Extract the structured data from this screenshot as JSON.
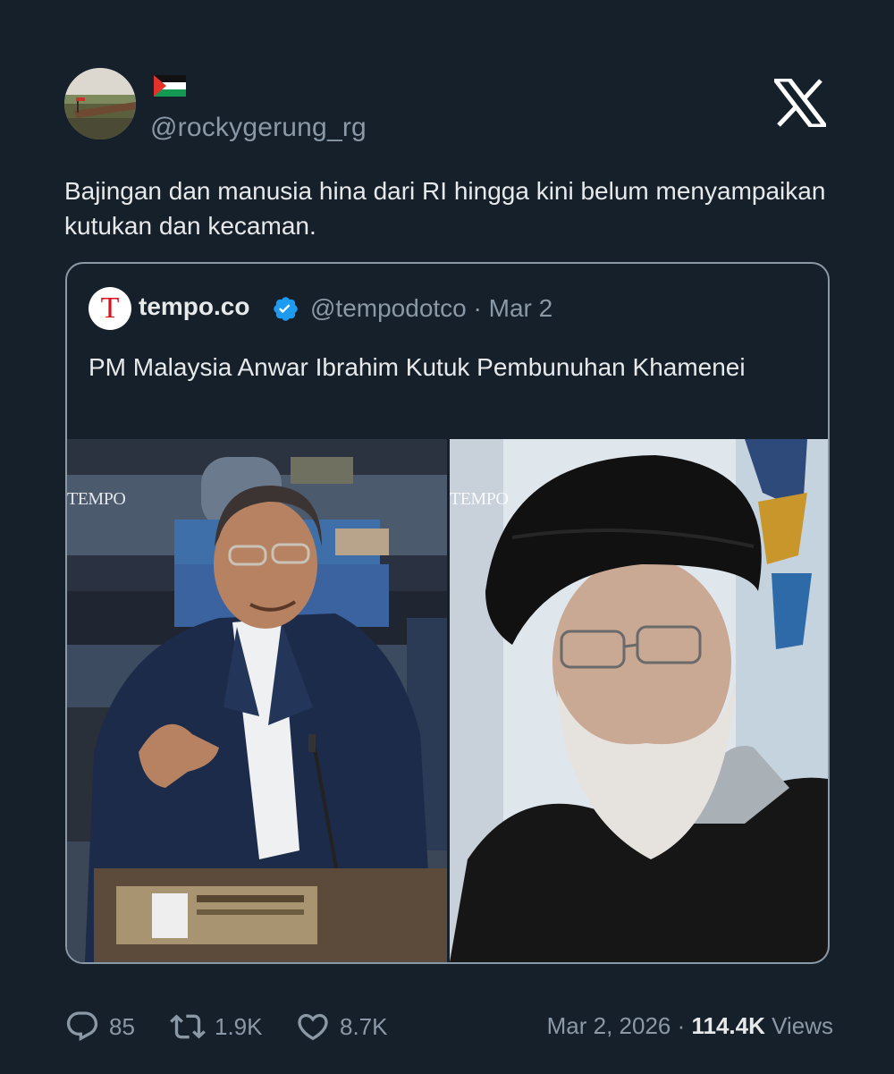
{
  "author": {
    "handle": "@rockygerung_rg",
    "flag_emoji": "palestine-flag"
  },
  "brand_icon": "x-logo-icon",
  "tweet": {
    "text": "Bajingan dan manusia hina dari RI hingga kini belum menyampaikan kutukan dan kecaman."
  },
  "quote": {
    "logo_letter": "T",
    "name": "tempo.co",
    "verified": true,
    "handle": "@tempodotco",
    "separator": " · ",
    "date": "Mar 2",
    "text": "PM Malaysia Anwar Ibrahim Kutuk Pembunuhan Khamenei",
    "watermark_left": "TEMPO",
    "watermark_right": "TEMPO"
  },
  "actions": {
    "replies": "85",
    "reposts": "1.9K",
    "likes": "8.7K",
    "date": "Mar 2, 2026",
    "separator": " · ",
    "views": "114.4K",
    "views_label": " Views"
  },
  "colors": {
    "background": "#15202b",
    "text_primary": "#e7e9ea",
    "text_secondary": "#8b98a5",
    "verified_blue": "#1d9bf0",
    "tempo_red": "#d8121f"
  }
}
